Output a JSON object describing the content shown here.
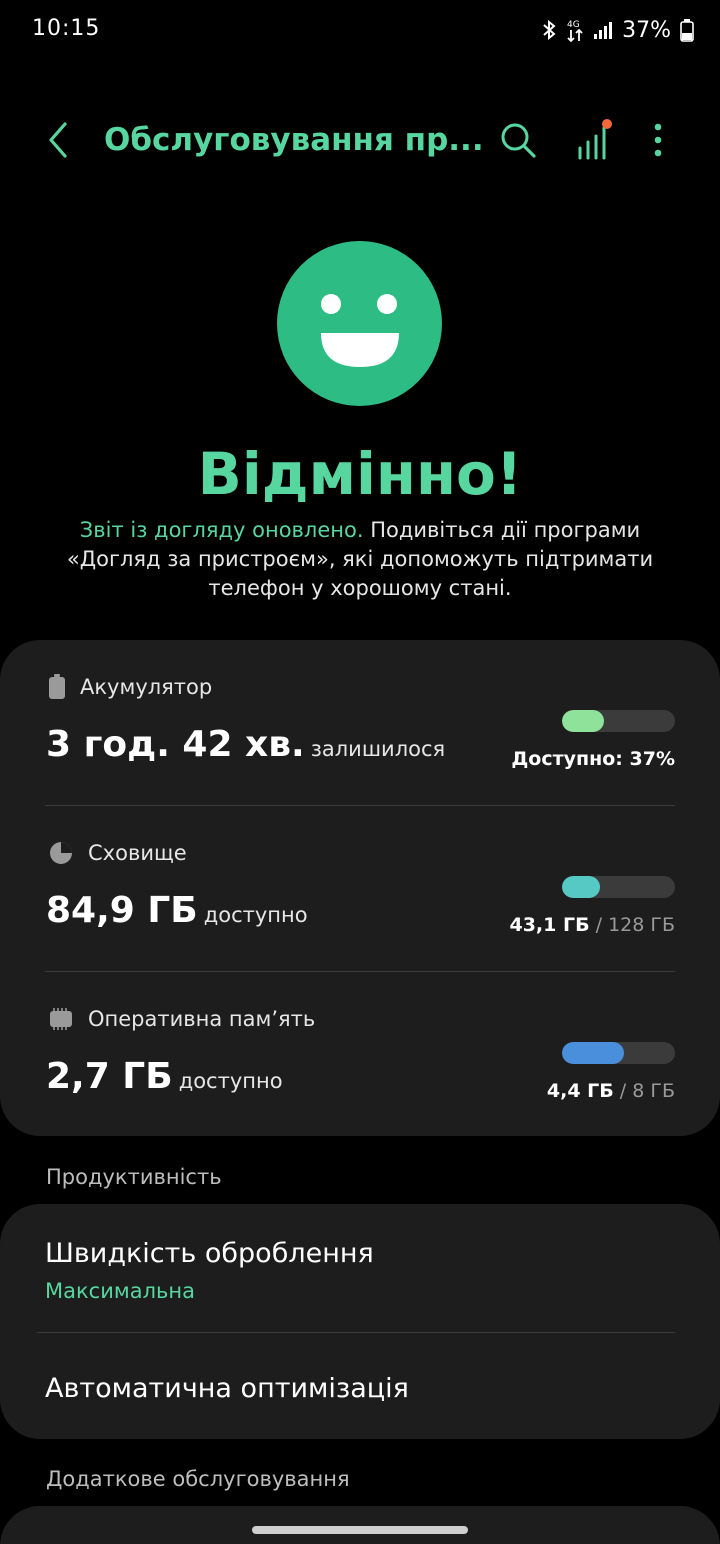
{
  "status_bar": {
    "time": "10:15",
    "battery_percent": "37%",
    "icons": [
      "bluetooth-icon",
      "data-transfer-icon",
      "signal-icon",
      "battery-icon"
    ]
  },
  "app_bar": {
    "title": "Обслуговування пр...",
    "back_icon": "chevron-left-icon",
    "search_icon": "search-icon",
    "stats_icon": "bar-chart-icon",
    "more_icon": "more-vert-icon"
  },
  "hero": {
    "icon": "smiley-face-icon",
    "title": "Відмінно!",
    "desc_accent": "Звіт із догляду оновлено.",
    "desc_rest": " Подивіться дії програми «Догляд за пристроєм», які допоможуть підтримати телефон у хорошому стані."
  },
  "stats": {
    "battery": {
      "label": "Акумулятор",
      "value": "3 год. 42 хв.",
      "suffix": "залишилося",
      "right_text": "Доступно: 37%",
      "progress": 0.37,
      "color": "#8fe29a"
    },
    "storage": {
      "label": "Сховище",
      "value": "84,9 ГБ",
      "suffix": "доступно",
      "used": "43,1 ГБ",
      "separator": " / ",
      "total": "128 ГБ",
      "progress": 0.337,
      "color": "#57c9c4"
    },
    "ram": {
      "label": "Оперативна пам’ять",
      "value": "2,7 ГБ",
      "suffix": "доступно",
      "used": "4,4 ГБ",
      "separator": " / ",
      "total": "8 ГБ",
      "progress": 0.55,
      "color": "#4a8fdc"
    }
  },
  "productivity": {
    "section_label": "Продуктивність",
    "processing_speed": {
      "title": "Швидкість оброблення",
      "value": "Максимальна"
    },
    "auto_optimization": {
      "title": "Автоматична оптимізація"
    }
  },
  "additional": {
    "section_label": "Додаткове обслуговування"
  },
  "colors": {
    "accent": "#57d6a0",
    "smiley": "#2dbd84",
    "card": "#1d1d1d",
    "notification_dot": "#ef6a3a"
  }
}
